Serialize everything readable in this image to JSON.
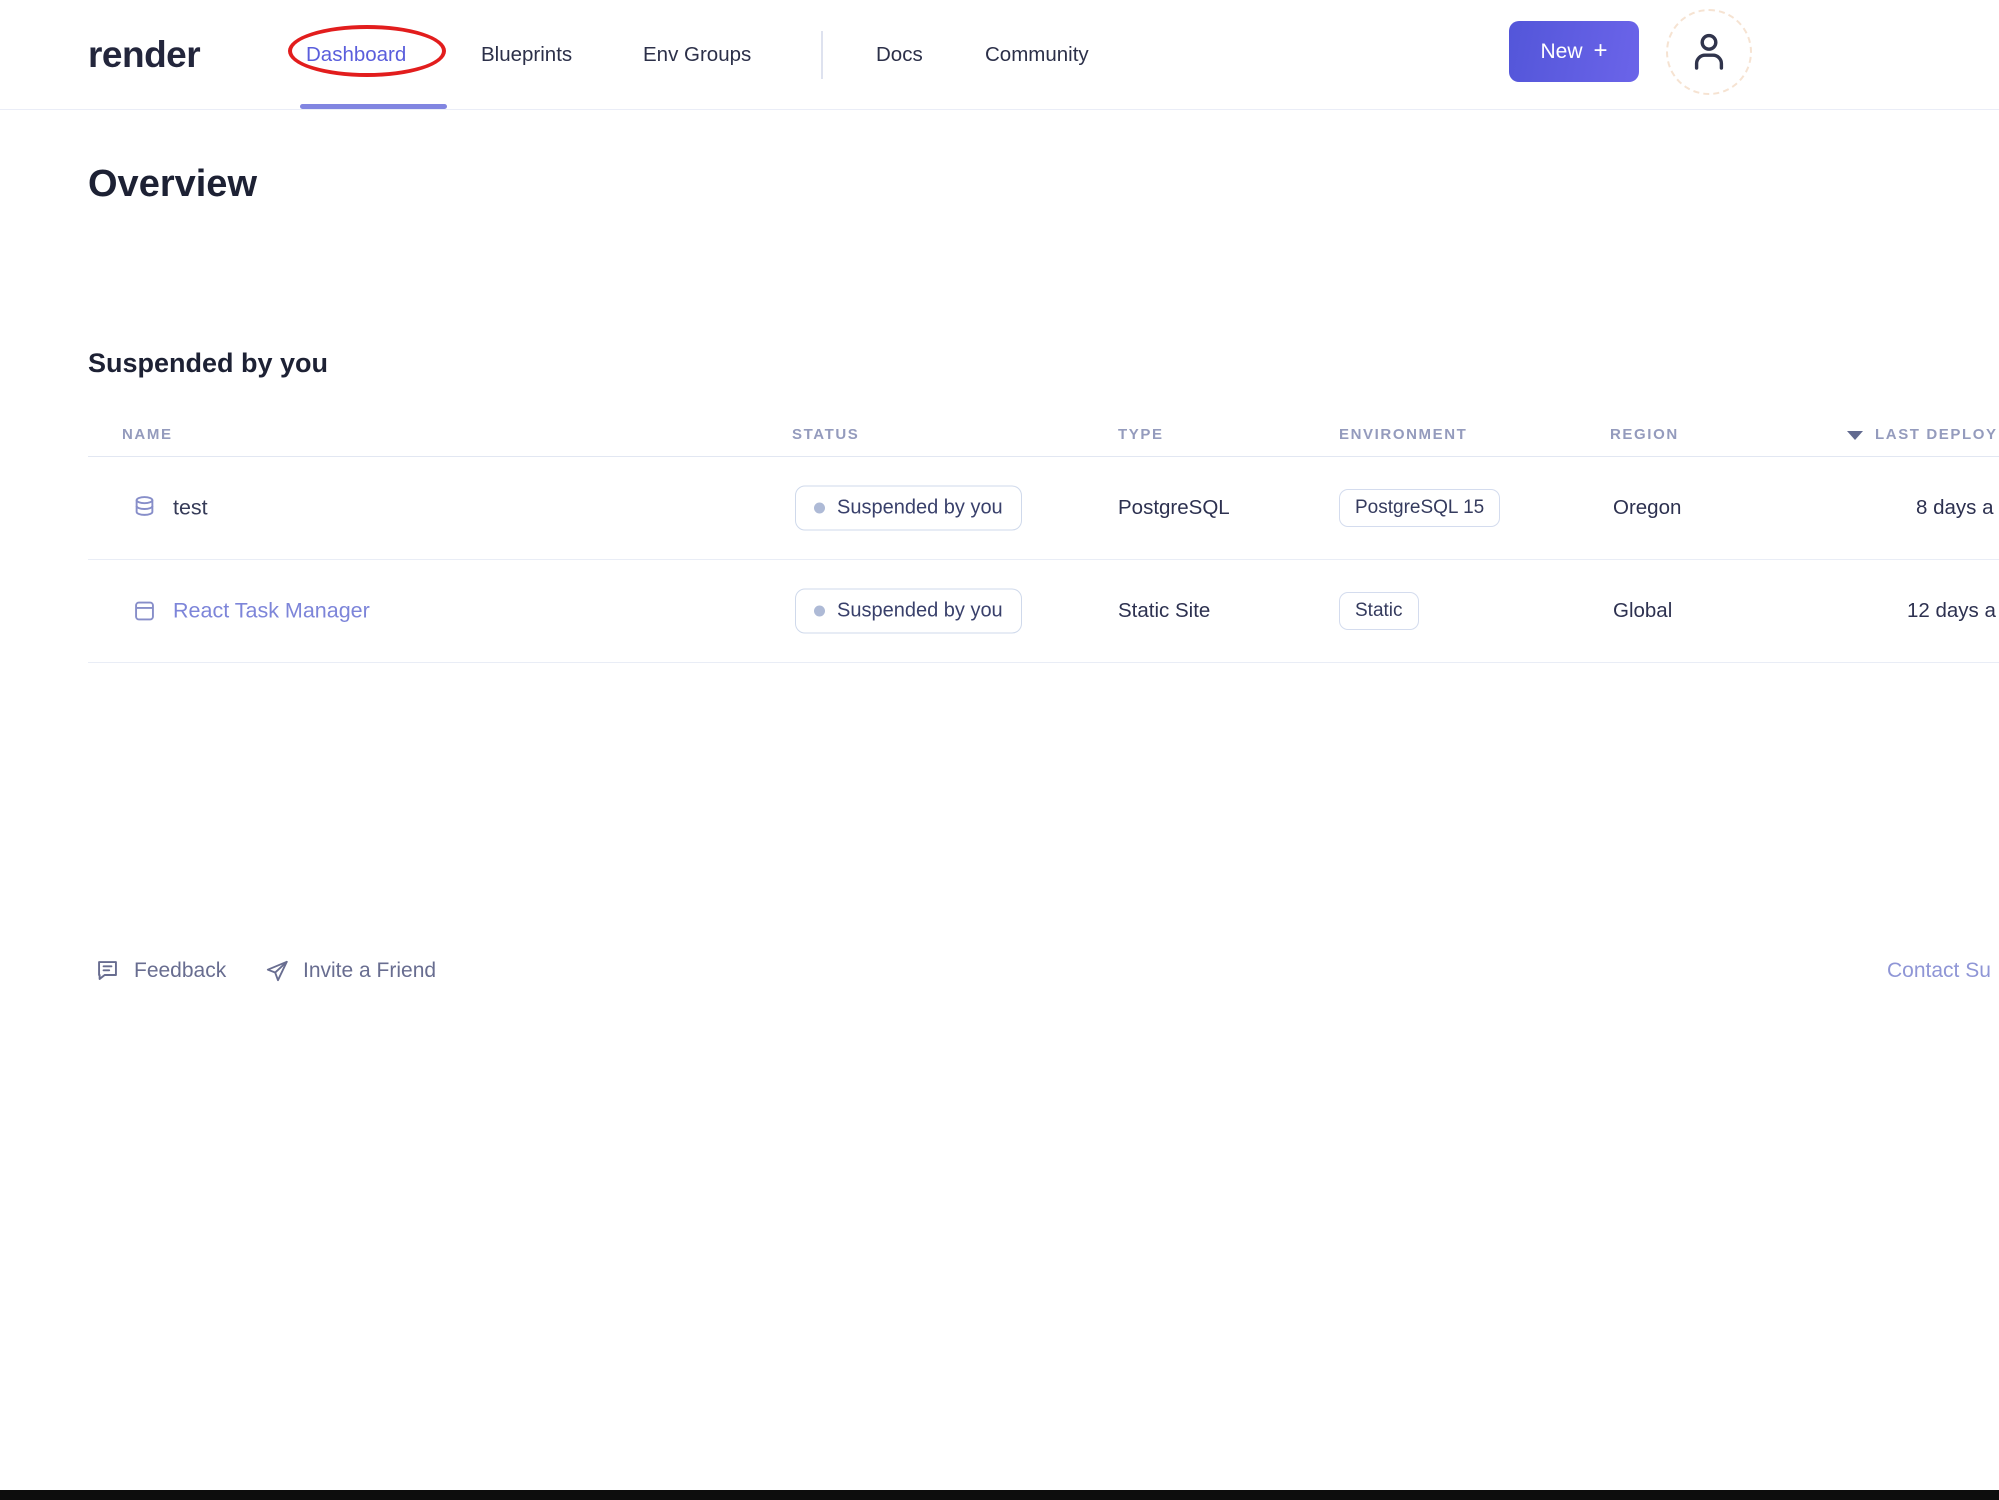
{
  "header": {
    "logo": "render",
    "nav": [
      {
        "label": "Dashboard",
        "active": true,
        "annotated": "red-ellipse"
      },
      {
        "label": "Blueprints",
        "active": false
      },
      {
        "label": "Env Groups",
        "active": false
      }
    ],
    "secondary_nav": [
      {
        "label": "Docs"
      },
      {
        "label": "Community"
      }
    ],
    "new_button": {
      "label": "New",
      "plus": "+"
    }
  },
  "page": {
    "title": "Overview",
    "section_heading": "Suspended by you"
  },
  "table": {
    "columns": {
      "name": "NAME",
      "status": "STATUS",
      "type": "TYPE",
      "environment": "ENVIRONMENT",
      "region": "REGION",
      "last_deploy": "LAST DEPLOY"
    },
    "sort": {
      "column": "LAST DEPLOY",
      "direction": "descending"
    },
    "rows": [
      {
        "icon": "database-icon",
        "name": "test",
        "status": "Suspended by you",
        "type": "PostgreSQL",
        "environment": "PostgreSQL 15",
        "region": "Oregon",
        "last_deploy": "8 days a"
      },
      {
        "icon": "static-site-icon",
        "name": "React Task Manager",
        "status": "Suspended by you",
        "type": "Static Site",
        "environment": "Static",
        "region": "Global",
        "last_deploy": "12 days a"
      }
    ]
  },
  "footer": {
    "feedback": "Feedback",
    "invite": "Invite a Friend",
    "contact_support": "Contact Su"
  },
  "colors": {
    "accent": "#5a5edc",
    "new_button_gradient_start": "#5356d9",
    "new_button_gradient_end": "#6b64e9",
    "active_underline": "#8185e1",
    "annotation_red": "#e21d1d",
    "row_link": "#7d85d9",
    "muted_column_header": "#949bbd",
    "badge_border": "#cfd9eb",
    "footer_text": "#686d90",
    "contact_link": "#8f96d6"
  }
}
